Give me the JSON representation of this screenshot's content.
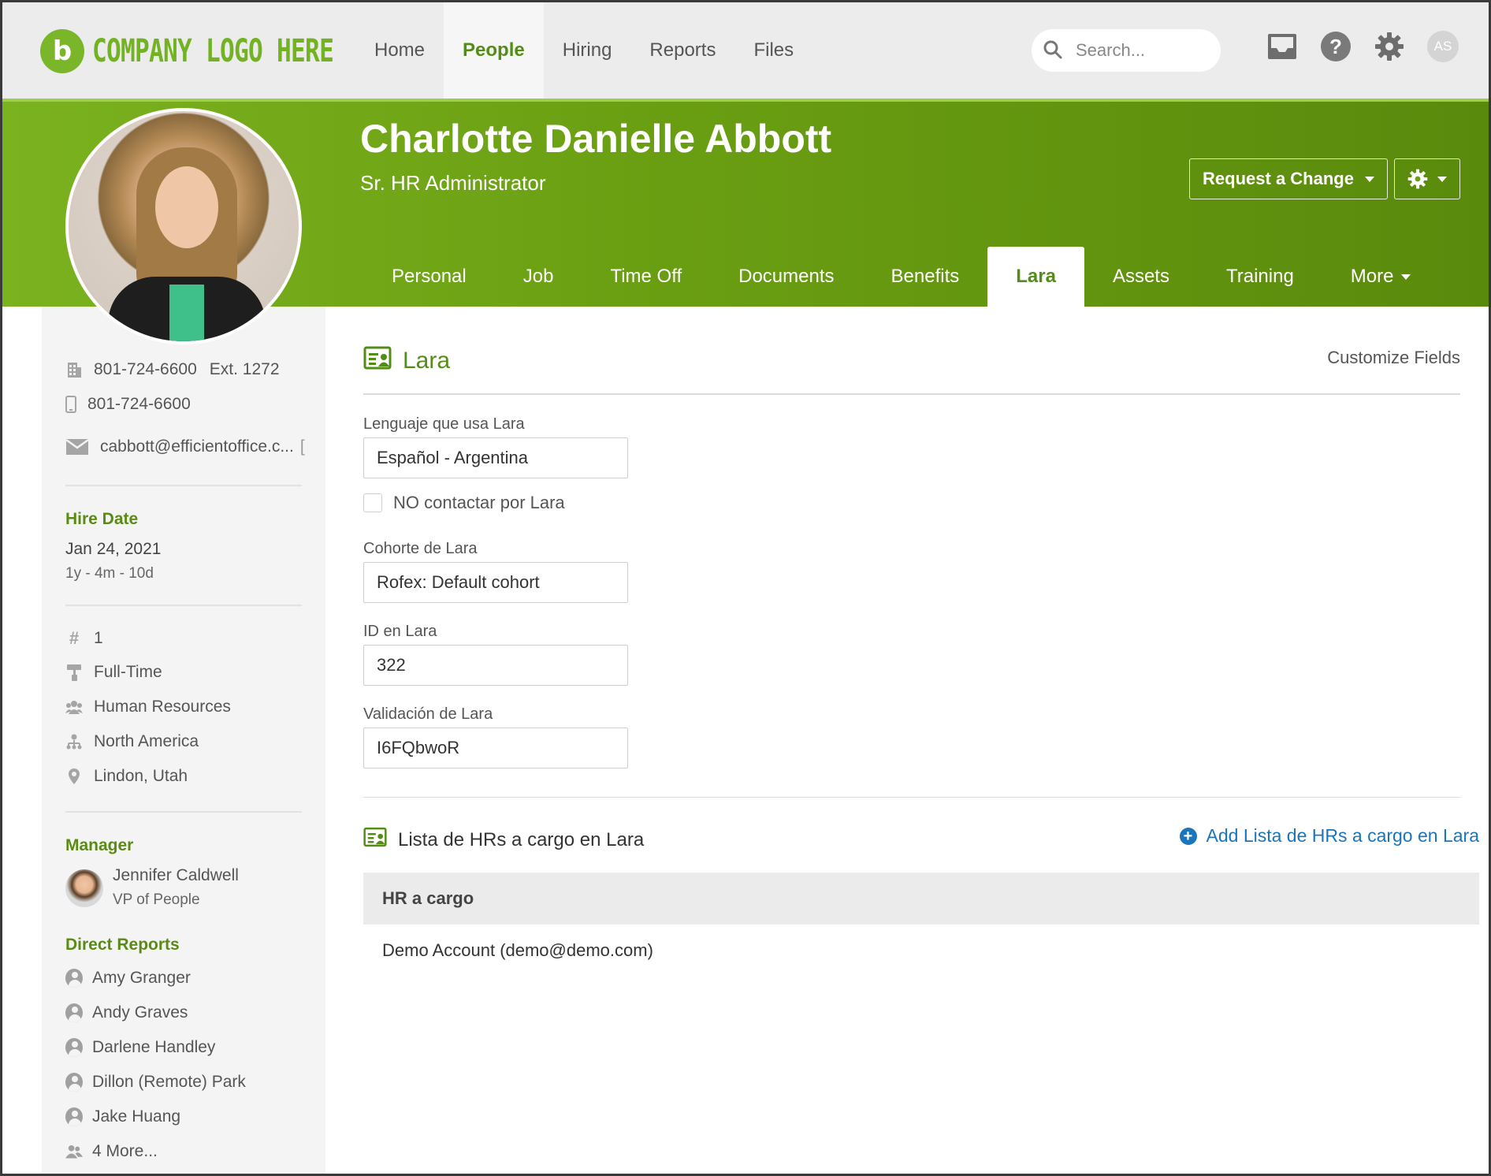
{
  "app": {
    "logo_text": "COMPANY LOGO HERE",
    "logo_mark": "b",
    "nav": [
      {
        "label": "Home"
      },
      {
        "label": "People",
        "active": true
      },
      {
        "label": "Hiring"
      },
      {
        "label": "Reports"
      },
      {
        "label": "Files"
      }
    ],
    "search_placeholder": "Search...",
    "user_initials": "AS",
    "icons": [
      "inbox-icon",
      "help-icon",
      "settings-gear-icon",
      "user-avatar"
    ],
    "help_glyph": "?"
  },
  "colors": {
    "brand_green": "#73b323",
    "banner_green": "#6a9e12",
    "accent_text_green": "#548d16",
    "link_blue": "#1b75bb"
  },
  "employee": {
    "name": "Charlotte Danielle Abbott",
    "title": "Sr. HR Administrator",
    "request_change_label": "Request a Change"
  },
  "tabs": [
    {
      "label": "Personal"
    },
    {
      "label": "Job"
    },
    {
      "label": "Time Off"
    },
    {
      "label": "Documents"
    },
    {
      "label": "Benefits"
    },
    {
      "label": "Lara",
      "active": true
    },
    {
      "label": "Assets"
    },
    {
      "label": "Training"
    },
    {
      "label": "More"
    }
  ],
  "sidebar": {
    "work_phone": "801-724-6600",
    "extension": "Ext. 1272",
    "mobile_phone": "801-724-6600",
    "email": "cabbott@efficientoffice.c...",
    "hire_date_label": "Hire Date",
    "hire_date": "Jan 24, 2021",
    "tenure": "1y - 4m - 10d",
    "employee_number": "1",
    "employment_status": "Full-Time",
    "department": "Human Resources",
    "division": "North America",
    "location": "Lindon, Utah",
    "manager_label": "Manager",
    "manager_name": "Jennifer Caldwell",
    "manager_title": "VP of People",
    "direct_reports_label": "Direct Reports",
    "direct_reports": [
      "Amy Granger",
      "Andy Graves",
      "Darlene Handley",
      "Dillon (Remote) Park",
      "Jake Huang"
    ],
    "more_reports": "4 More..."
  },
  "main": {
    "section_title": "Lara",
    "customize_label": "Customize Fields",
    "fields": [
      {
        "label": "Lenguaje que usa Lara",
        "value": "Español - Argentina"
      },
      {
        "label": "Cohorte de Lara",
        "value": "Rofex: Default cohort"
      },
      {
        "label": "ID en Lara",
        "value": "322"
      },
      {
        "label": "Validación de Lara",
        "value": "I6FQbwoR"
      }
    ],
    "checkbox_label": "NO contactar por Lara",
    "checkbox_checked": false,
    "list_title": "Lista de HRs a cargo en Lara",
    "add_label": "Add Lista de HRs a cargo en Lara",
    "table_header": "HR a cargo",
    "table_rows": [
      "Demo Account (demo@demo.com)"
    ]
  }
}
